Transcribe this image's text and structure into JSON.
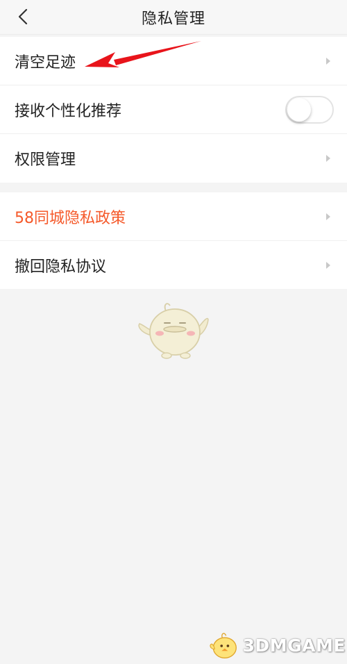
{
  "header": {
    "title": "隐私管理",
    "back_icon": "chevron-left-icon"
  },
  "group1": {
    "items": [
      {
        "label": "清空足迹",
        "control": "chevron-right-icon"
      },
      {
        "label": "接收个性化推荐",
        "control": "toggle",
        "toggle_on": false
      },
      {
        "label": "权限管理",
        "control": "chevron-right-icon"
      }
    ]
  },
  "group2": {
    "items": [
      {
        "label": "58同城隐私政策",
        "control": "chevron-right-icon",
        "color": "#f5592a"
      },
      {
        "label": "撤回隐私协议",
        "control": "chevron-right-icon"
      }
    ]
  },
  "annotation": {
    "type": "red-arrow",
    "color": "#e8141b"
  },
  "mascot": {
    "icon": "chick-mascot-icon"
  },
  "watermark": {
    "text": "3DMGAME"
  },
  "colors": {
    "accent": "#f5592a",
    "background": "#f4f4f4",
    "row_bg": "#ffffff"
  }
}
